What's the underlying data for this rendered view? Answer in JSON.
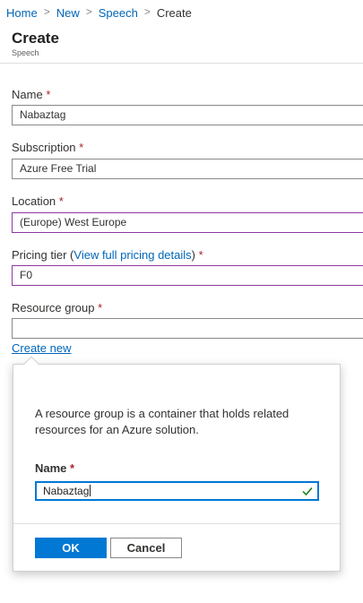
{
  "breadcrumb": {
    "items": [
      "Home",
      "New",
      "Speech"
    ],
    "current": "Create",
    "separator": ">"
  },
  "header": {
    "title": "Create",
    "subtitle": "Speech"
  },
  "form": {
    "required_marker": "*",
    "name": {
      "label": "Name",
      "value": "Nabaztag"
    },
    "subscription": {
      "label": "Subscription",
      "value": "Azure Free Trial"
    },
    "location": {
      "label": "Location",
      "value": "(Europe) West Europe"
    },
    "pricing": {
      "label": "Pricing tier",
      "open_paren": "(",
      "link": "View full pricing details",
      "close_paren": ")",
      "value": "F0"
    },
    "resource_group": {
      "label": "Resource group",
      "value": "",
      "create_new": "Create new"
    }
  },
  "popup": {
    "description": "A resource group is a container that holds related resources for an Azure solution.",
    "name_label": "Name",
    "name_value": "Nabaztag",
    "ok_label": "OK",
    "cancel_label": "Cancel"
  },
  "colors": {
    "link": "#0066b8",
    "primary": "#0078d4",
    "required": "#a4262c",
    "focus_border": "#8b3a9e",
    "valid_check": "#107c10"
  }
}
